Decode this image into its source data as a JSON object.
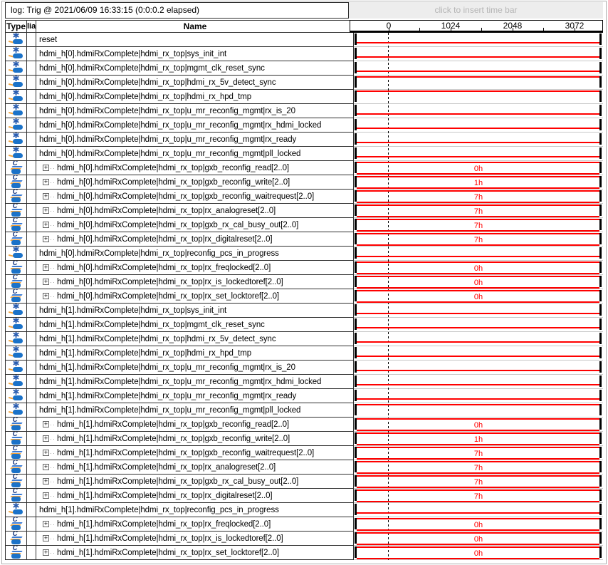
{
  "window": {
    "log_title": "log: Trig @ 2021/06/09 16:33:15 (0:0:0.2 elapsed)",
    "timebar_hint": "click to insert time bar"
  },
  "columns": {
    "type": "Type",
    "alias": "lia",
    "name": "Name"
  },
  "ruler": {
    "ticks": [
      "0",
      "1024",
      "2048",
      "3072"
    ]
  },
  "ui": {
    "expand_glyph": "+",
    "bit_icon_glyph": "✱",
    "bus_icon_glyph": "C"
  },
  "colors": {
    "trace_red": "#ff0000",
    "icon_blue": "#1b72c8",
    "icon_dark_blue": "#1f3f85",
    "icon_orange": "#f2a33c",
    "hint_gray": "#b5b5b5",
    "row_separator": "#c8c8c8"
  },
  "signals": [
    {
      "kind": "bit",
      "name": "reset",
      "level": "low"
    },
    {
      "kind": "bit",
      "name": "hdmi_h[0].hdmiRxComplete|hdmi_rx_top|sys_init_int",
      "level": "low"
    },
    {
      "kind": "bit",
      "name": "hdmi_h[0].hdmiRxComplete|hdmi_rx_top|mgmt_clk_reset_sync",
      "level": "low"
    },
    {
      "kind": "bit",
      "name": "hdmi_h[0].hdmiRxComplete|hdmi_rx_top|hdmi_rx_5v_detect_sync",
      "level": "high"
    },
    {
      "kind": "bit",
      "name": "hdmi_h[0].hdmiRxComplete|hdmi_rx_top|hdmi_rx_hpd_tmp",
      "level": "high"
    },
    {
      "kind": "bit",
      "name": "hdmi_h[0].hdmiRxComplete|hdmi_rx_top|u_mr_reconfig_mgmt|rx_is_20",
      "level": "low"
    },
    {
      "kind": "bit",
      "name": "hdmi_h[0].hdmiRxComplete|hdmi_rx_top|u_mr_reconfig_mgmt|rx_hdmi_locked",
      "level": "low"
    },
    {
      "kind": "bit",
      "name": "hdmi_h[0].hdmiRxComplete|hdmi_rx_top|u_mr_reconfig_mgmt|rx_ready",
      "level": "low"
    },
    {
      "kind": "bit",
      "name": "hdmi_h[0].hdmiRxComplete|hdmi_rx_top|u_mr_reconfig_mgmt|pll_locked",
      "level": "low"
    },
    {
      "kind": "bus",
      "name": "hdmi_h[0].hdmiRxComplete|hdmi_rx_top|gxb_reconfig_read[2..0]",
      "value": "0h"
    },
    {
      "kind": "bus",
      "name": "hdmi_h[0].hdmiRxComplete|hdmi_rx_top|gxb_reconfig_write[2..0]",
      "value": "1h"
    },
    {
      "kind": "bus",
      "name": "hdmi_h[0].hdmiRxComplete|hdmi_rx_top|gxb_reconfig_waitrequest[2..0]",
      "value": "7h"
    },
    {
      "kind": "bus",
      "name": "hdmi_h[0].hdmiRxComplete|hdmi_rx_top|rx_analogreset[2..0]",
      "value": "7h"
    },
    {
      "kind": "bus",
      "name": "hdmi_h[0].hdmiRxComplete|hdmi_rx_top|gxb_rx_cal_busy_out[2..0]",
      "value": "7h"
    },
    {
      "kind": "bus",
      "name": "hdmi_h[0].hdmiRxComplete|hdmi_rx_top|rx_digitalreset[2..0]",
      "value": "7h"
    },
    {
      "kind": "bit",
      "name": "hdmi_h[0].hdmiRxComplete|hdmi_rx_top|reconfig_pcs_in_progress",
      "level": "low"
    },
    {
      "kind": "bus",
      "name": "hdmi_h[0].hdmiRxComplete|hdmi_rx_top|rx_freqlocked[2..0]",
      "value": "0h"
    },
    {
      "kind": "bus",
      "name": "hdmi_h[0].hdmiRxComplete|hdmi_rx_top|rx_is_lockedtoref[2..0]",
      "value": "0h"
    },
    {
      "kind": "bus",
      "name": "hdmi_h[0].hdmiRxComplete|hdmi_rx_top|rx_set_locktoref[2..0]",
      "value": "0h"
    },
    {
      "kind": "bit",
      "name": "hdmi_h[1].hdmiRxComplete|hdmi_rx_top|sys_init_int",
      "level": "low"
    },
    {
      "kind": "bit",
      "name": "hdmi_h[1].hdmiRxComplete|hdmi_rx_top|mgmt_clk_reset_sync",
      "level": "low"
    },
    {
      "kind": "bit",
      "name": "hdmi_h[1].hdmiRxComplete|hdmi_rx_top|hdmi_rx_5v_detect_sync",
      "level": "low"
    },
    {
      "kind": "bit",
      "name": "hdmi_h[1].hdmiRxComplete|hdmi_rx_top|hdmi_rx_hpd_tmp",
      "level": "low"
    },
    {
      "kind": "bit",
      "name": "hdmi_h[1].hdmiRxComplete|hdmi_rx_top|u_mr_reconfig_mgmt|rx_is_20",
      "level": "low"
    },
    {
      "kind": "bit",
      "name": "hdmi_h[1].hdmiRxComplete|hdmi_rx_top|u_mr_reconfig_mgmt|rx_hdmi_locked",
      "level": "low"
    },
    {
      "kind": "bit",
      "name": "hdmi_h[1].hdmiRxComplete|hdmi_rx_top|u_mr_reconfig_mgmt|rx_ready",
      "level": "low"
    },
    {
      "kind": "bit",
      "name": "hdmi_h[1].hdmiRxComplete|hdmi_rx_top|u_mr_reconfig_mgmt|pll_locked",
      "level": "high"
    },
    {
      "kind": "bus",
      "name": "hdmi_h[1].hdmiRxComplete|hdmi_rx_top|gxb_reconfig_read[2..0]",
      "value": "0h"
    },
    {
      "kind": "bus",
      "name": "hdmi_h[1].hdmiRxComplete|hdmi_rx_top|gxb_reconfig_write[2..0]",
      "value": "1h"
    },
    {
      "kind": "bus",
      "name": "hdmi_h[1].hdmiRxComplete|hdmi_rx_top|gxb_reconfig_waitrequest[2..0]",
      "value": "7h"
    },
    {
      "kind": "bus",
      "name": "hdmi_h[1].hdmiRxComplete|hdmi_rx_top|rx_analogreset[2..0]",
      "value": "7h"
    },
    {
      "kind": "bus",
      "name": "hdmi_h[1].hdmiRxComplete|hdmi_rx_top|gxb_rx_cal_busy_out[2..0]",
      "value": "7h"
    },
    {
      "kind": "bus",
      "name": "hdmi_h[1].hdmiRxComplete|hdmi_rx_top|rx_digitalreset[2..0]",
      "value": "7h"
    },
    {
      "kind": "bit",
      "name": "hdmi_h[1].hdmiRxComplete|hdmi_rx_top|reconfig_pcs_in_progress",
      "level": "low"
    },
    {
      "kind": "bus",
      "name": "hdmi_h[1].hdmiRxComplete|hdmi_rx_top|rx_freqlocked[2..0]",
      "value": "0h"
    },
    {
      "kind": "bus",
      "name": "hdmi_h[1].hdmiRxComplete|hdmi_rx_top|rx_is_lockedtoref[2..0]",
      "value": "0h"
    },
    {
      "kind": "bus",
      "name": "hdmi_h[1].hdmiRxComplete|hdmi_rx_top|rx_set_locktoref[2..0]",
      "value": "0h"
    }
  ]
}
